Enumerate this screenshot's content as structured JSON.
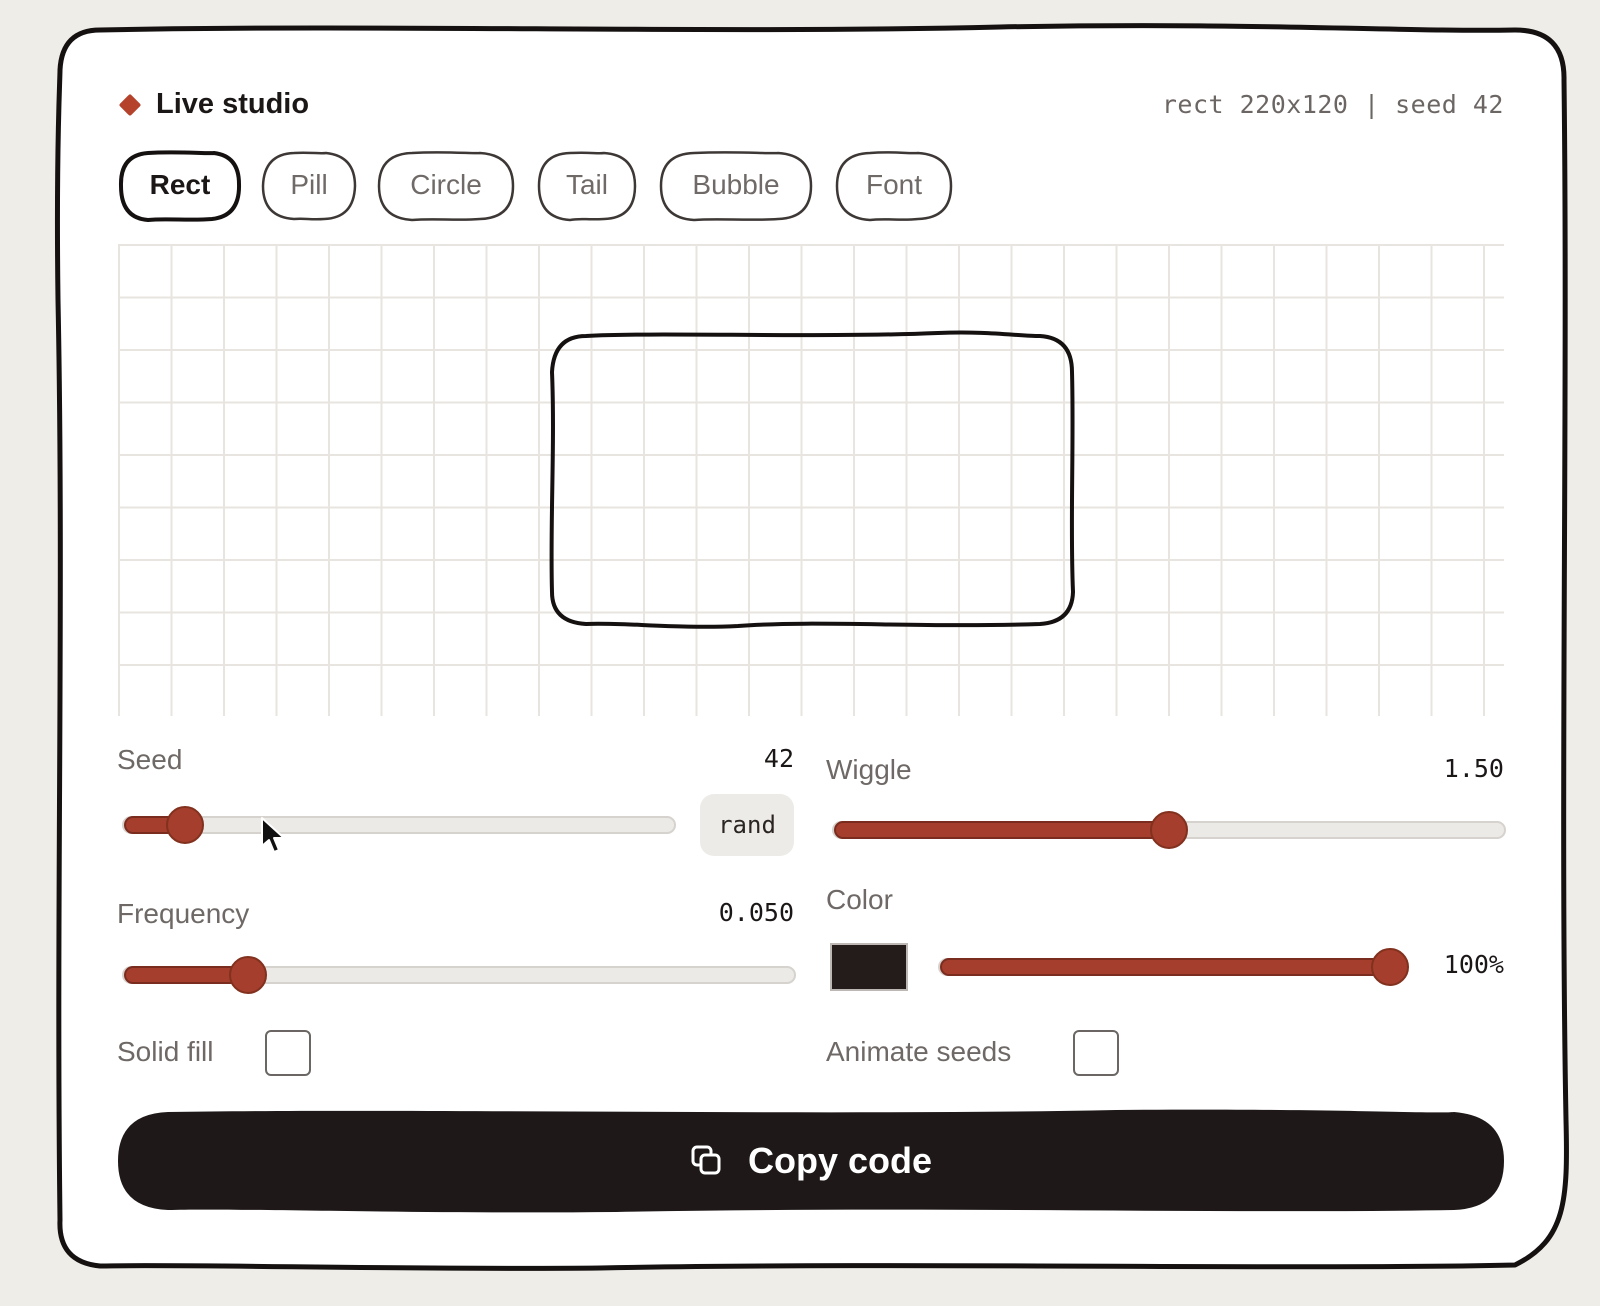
{
  "header": {
    "title": "Live studio",
    "meta": "rect 220x120 | seed 42"
  },
  "tabs": [
    {
      "label": "Rect",
      "active": true
    },
    {
      "label": "Pill",
      "active": false
    },
    {
      "label": "Circle",
      "active": false
    },
    {
      "label": "Tail",
      "active": false
    },
    {
      "label": "Bubble",
      "active": false
    },
    {
      "label": "Font",
      "active": false
    }
  ],
  "controls": {
    "seed": {
      "label": "Seed",
      "value": "42",
      "fill": 0.11,
      "rand_label": "rand"
    },
    "wiggle": {
      "label": "Wiggle",
      "value": "1.50",
      "fill": 0.5
    },
    "frequency": {
      "label": "Frequency",
      "value": "0.050",
      "fill": 0.185
    },
    "color": {
      "label": "Color",
      "swatch": "#241c1b",
      "opacity": "100%",
      "fill": 1.0
    },
    "solid_fill": {
      "label": "Solid fill",
      "checked": false
    },
    "animate_seeds": {
      "label": "Animate seeds",
      "checked": false
    }
  },
  "copy": {
    "label": "Copy code",
    "icon": "copy-icon"
  },
  "colors": {
    "accent": "#a53e2c",
    "ink": "#1c1717",
    "background": "#eeede8"
  }
}
